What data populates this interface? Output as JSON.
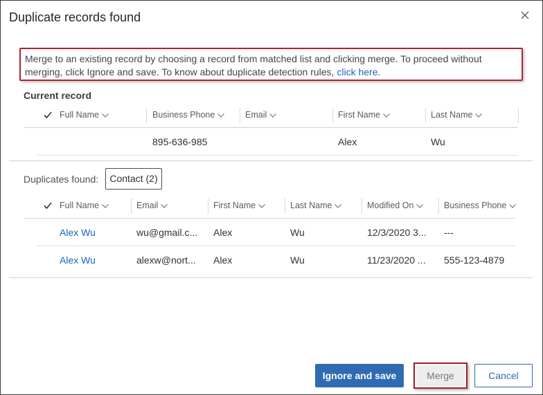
{
  "dialog": {
    "title": "Duplicate records found",
    "notice_text": "Merge to an existing record by choosing a record from matched list and clicking merge. To proceed without merging, click Ignore and save. To know about duplicate detection rules, ",
    "notice_link": "click here",
    "notice_end": "."
  },
  "current": {
    "label": "Current record",
    "columns": [
      "Full Name",
      "Business Phone",
      "Email",
      "First Name",
      "Last Name"
    ],
    "row": {
      "full_name": "",
      "business_phone": "895-636-985",
      "email": "",
      "first_name": "Alex",
      "last_name": "Wu"
    }
  },
  "duplicates": {
    "label": "Duplicates found:",
    "tab": "Contact (2)",
    "columns": [
      "Full Name",
      "Email",
      "First Name",
      "Last Name",
      "Modified On",
      "Business Phone"
    ],
    "rows": [
      {
        "full_name": "Alex Wu",
        "email": "wu@gmail.c...",
        "first_name": "Alex",
        "last_name": "Wu",
        "modified_on": "12/3/2020 3...",
        "business_phone": "---"
      },
      {
        "full_name": "Alex Wu",
        "email": "alexw@nort...",
        "first_name": "Alex",
        "last_name": "Wu",
        "modified_on": "11/23/2020 ...",
        "business_phone": "555-123-4879"
      }
    ]
  },
  "buttons": {
    "ignore_save": "Ignore and save",
    "merge": "Merge",
    "cancel": "Cancel"
  },
  "colors": {
    "accent": "#2f6bb3",
    "highlight": "#b3222b",
    "link": "#1664b5"
  }
}
